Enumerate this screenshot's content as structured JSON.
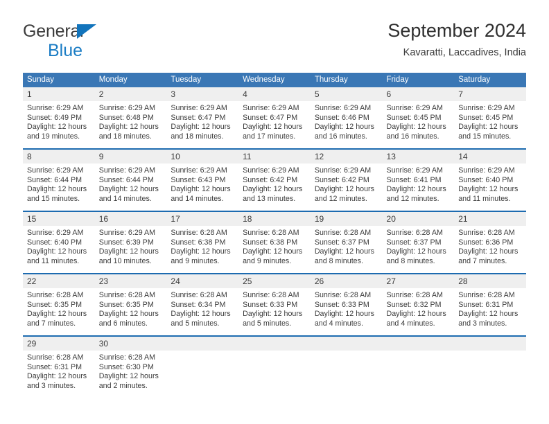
{
  "logo": {
    "word1": "General",
    "word2": "Blue"
  },
  "header": {
    "title": "September 2024",
    "location": "Kavaratti, Laccadives, India"
  },
  "colors": {
    "header_blue": "#3a77b5",
    "separator_blue": "#1d6bb0",
    "daynum_band": "#efefef",
    "logo_blue": "#1a7cc4"
  },
  "weekday_headers": [
    "Sunday",
    "Monday",
    "Tuesday",
    "Wednesday",
    "Thursday",
    "Friday",
    "Saturday"
  ],
  "weeks": [
    {
      "days": [
        {
          "num": "1",
          "sunrise": "Sunrise: 6:29 AM",
          "sunset": "Sunset: 6:49 PM",
          "daylight1": "Daylight: 12 hours",
          "daylight2": "and 19 minutes."
        },
        {
          "num": "2",
          "sunrise": "Sunrise: 6:29 AM",
          "sunset": "Sunset: 6:48 PM",
          "daylight1": "Daylight: 12 hours",
          "daylight2": "and 18 minutes."
        },
        {
          "num": "3",
          "sunrise": "Sunrise: 6:29 AM",
          "sunset": "Sunset: 6:47 PM",
          "daylight1": "Daylight: 12 hours",
          "daylight2": "and 18 minutes."
        },
        {
          "num": "4",
          "sunrise": "Sunrise: 6:29 AM",
          "sunset": "Sunset: 6:47 PM",
          "daylight1": "Daylight: 12 hours",
          "daylight2": "and 17 minutes."
        },
        {
          "num": "5",
          "sunrise": "Sunrise: 6:29 AM",
          "sunset": "Sunset: 6:46 PM",
          "daylight1": "Daylight: 12 hours",
          "daylight2": "and 16 minutes."
        },
        {
          "num": "6",
          "sunrise": "Sunrise: 6:29 AM",
          "sunset": "Sunset: 6:45 PM",
          "daylight1": "Daylight: 12 hours",
          "daylight2": "and 16 minutes."
        },
        {
          "num": "7",
          "sunrise": "Sunrise: 6:29 AM",
          "sunset": "Sunset: 6:45 PM",
          "daylight1": "Daylight: 12 hours",
          "daylight2": "and 15 minutes."
        }
      ]
    },
    {
      "days": [
        {
          "num": "8",
          "sunrise": "Sunrise: 6:29 AM",
          "sunset": "Sunset: 6:44 PM",
          "daylight1": "Daylight: 12 hours",
          "daylight2": "and 15 minutes."
        },
        {
          "num": "9",
          "sunrise": "Sunrise: 6:29 AM",
          "sunset": "Sunset: 6:44 PM",
          "daylight1": "Daylight: 12 hours",
          "daylight2": "and 14 minutes."
        },
        {
          "num": "10",
          "sunrise": "Sunrise: 6:29 AM",
          "sunset": "Sunset: 6:43 PM",
          "daylight1": "Daylight: 12 hours",
          "daylight2": "and 14 minutes."
        },
        {
          "num": "11",
          "sunrise": "Sunrise: 6:29 AM",
          "sunset": "Sunset: 6:42 PM",
          "daylight1": "Daylight: 12 hours",
          "daylight2": "and 13 minutes."
        },
        {
          "num": "12",
          "sunrise": "Sunrise: 6:29 AM",
          "sunset": "Sunset: 6:42 PM",
          "daylight1": "Daylight: 12 hours",
          "daylight2": "and 12 minutes."
        },
        {
          "num": "13",
          "sunrise": "Sunrise: 6:29 AM",
          "sunset": "Sunset: 6:41 PM",
          "daylight1": "Daylight: 12 hours",
          "daylight2": "and 12 minutes."
        },
        {
          "num": "14",
          "sunrise": "Sunrise: 6:29 AM",
          "sunset": "Sunset: 6:40 PM",
          "daylight1": "Daylight: 12 hours",
          "daylight2": "and 11 minutes."
        }
      ]
    },
    {
      "days": [
        {
          "num": "15",
          "sunrise": "Sunrise: 6:29 AM",
          "sunset": "Sunset: 6:40 PM",
          "daylight1": "Daylight: 12 hours",
          "daylight2": "and 11 minutes."
        },
        {
          "num": "16",
          "sunrise": "Sunrise: 6:29 AM",
          "sunset": "Sunset: 6:39 PM",
          "daylight1": "Daylight: 12 hours",
          "daylight2": "and 10 minutes."
        },
        {
          "num": "17",
          "sunrise": "Sunrise: 6:28 AM",
          "sunset": "Sunset: 6:38 PM",
          "daylight1": "Daylight: 12 hours",
          "daylight2": "and 9 minutes."
        },
        {
          "num": "18",
          "sunrise": "Sunrise: 6:28 AM",
          "sunset": "Sunset: 6:38 PM",
          "daylight1": "Daylight: 12 hours",
          "daylight2": "and 9 minutes."
        },
        {
          "num": "19",
          "sunrise": "Sunrise: 6:28 AM",
          "sunset": "Sunset: 6:37 PM",
          "daylight1": "Daylight: 12 hours",
          "daylight2": "and 8 minutes."
        },
        {
          "num": "20",
          "sunrise": "Sunrise: 6:28 AM",
          "sunset": "Sunset: 6:37 PM",
          "daylight1": "Daylight: 12 hours",
          "daylight2": "and 8 minutes."
        },
        {
          "num": "21",
          "sunrise": "Sunrise: 6:28 AM",
          "sunset": "Sunset: 6:36 PM",
          "daylight1": "Daylight: 12 hours",
          "daylight2": "and 7 minutes."
        }
      ]
    },
    {
      "days": [
        {
          "num": "22",
          "sunrise": "Sunrise: 6:28 AM",
          "sunset": "Sunset: 6:35 PM",
          "daylight1": "Daylight: 12 hours",
          "daylight2": "and 7 minutes."
        },
        {
          "num": "23",
          "sunrise": "Sunrise: 6:28 AM",
          "sunset": "Sunset: 6:35 PM",
          "daylight1": "Daylight: 12 hours",
          "daylight2": "and 6 minutes."
        },
        {
          "num": "24",
          "sunrise": "Sunrise: 6:28 AM",
          "sunset": "Sunset: 6:34 PM",
          "daylight1": "Daylight: 12 hours",
          "daylight2": "and 5 minutes."
        },
        {
          "num": "25",
          "sunrise": "Sunrise: 6:28 AM",
          "sunset": "Sunset: 6:33 PM",
          "daylight1": "Daylight: 12 hours",
          "daylight2": "and 5 minutes."
        },
        {
          "num": "26",
          "sunrise": "Sunrise: 6:28 AM",
          "sunset": "Sunset: 6:33 PM",
          "daylight1": "Daylight: 12 hours",
          "daylight2": "and 4 minutes."
        },
        {
          "num": "27",
          "sunrise": "Sunrise: 6:28 AM",
          "sunset": "Sunset: 6:32 PM",
          "daylight1": "Daylight: 12 hours",
          "daylight2": "and 4 minutes."
        },
        {
          "num": "28",
          "sunrise": "Sunrise: 6:28 AM",
          "sunset": "Sunset: 6:31 PM",
          "daylight1": "Daylight: 12 hours",
          "daylight2": "and 3 minutes."
        }
      ]
    },
    {
      "days": [
        {
          "num": "29",
          "sunrise": "Sunrise: 6:28 AM",
          "sunset": "Sunset: 6:31 PM",
          "daylight1": "Daylight: 12 hours",
          "daylight2": "and 3 minutes."
        },
        {
          "num": "30",
          "sunrise": "Sunrise: 6:28 AM",
          "sunset": "Sunset: 6:30 PM",
          "daylight1": "Daylight: 12 hours",
          "daylight2": "and 2 minutes."
        },
        {
          "num": "",
          "sunrise": "",
          "sunset": "",
          "daylight1": "",
          "daylight2": ""
        },
        {
          "num": "",
          "sunrise": "",
          "sunset": "",
          "daylight1": "",
          "daylight2": ""
        },
        {
          "num": "",
          "sunrise": "",
          "sunset": "",
          "daylight1": "",
          "daylight2": ""
        },
        {
          "num": "",
          "sunrise": "",
          "sunset": "",
          "daylight1": "",
          "daylight2": ""
        },
        {
          "num": "",
          "sunrise": "",
          "sunset": "",
          "daylight1": "",
          "daylight2": ""
        }
      ]
    }
  ]
}
